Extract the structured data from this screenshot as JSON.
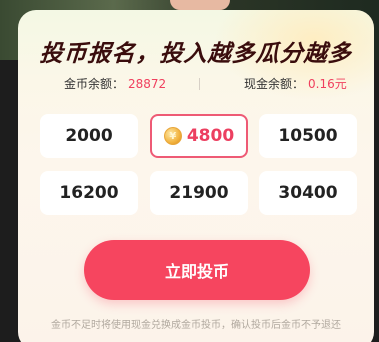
{
  "title": "投币报名，投入越多瓜分越多",
  "balances": {
    "coin_label": "金币余额：",
    "coin_value": "28872",
    "cash_label": "现金余额：",
    "cash_value": "0.16元"
  },
  "amounts": [
    {
      "value": "2000",
      "selected": false
    },
    {
      "value": "4800",
      "selected": true
    },
    {
      "value": "10500",
      "selected": false
    },
    {
      "value": "16200",
      "selected": false
    },
    {
      "value": "21900",
      "selected": false
    },
    {
      "value": "30400",
      "selected": false
    }
  ],
  "coin_icon_glyph": "¥",
  "cta_label": "立即投币",
  "footnote": "金币不足时将使用现金兑换成金币投币，确认投币后金币不予退还",
  "colors": {
    "accent": "#f6455f",
    "selected_border": "#ee5a75",
    "value_red": "#f0405e",
    "title": "#3a0d0d"
  }
}
